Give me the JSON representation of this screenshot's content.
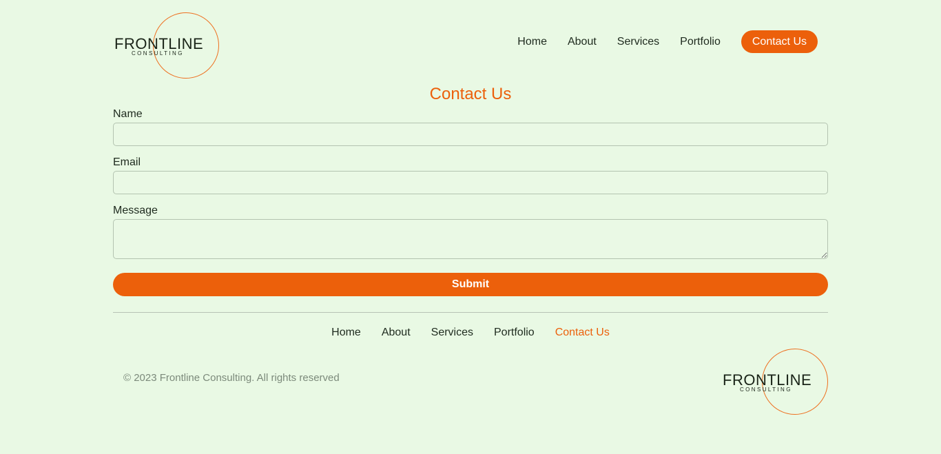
{
  "brand": {
    "name": "FRONTLINE",
    "tagline": "CONSULTING"
  },
  "header": {
    "nav": [
      "Home",
      "About",
      "Services",
      "Portfolio"
    ],
    "cta_label": "Contact Us"
  },
  "form": {
    "title": "Contact Us",
    "name_label": "Name",
    "name_value": "",
    "email_label": "Email",
    "email_value": "",
    "message_label": "Message",
    "message_value": "",
    "submit_label": "Submit"
  },
  "footer": {
    "nav": [
      "Home",
      "About",
      "Services",
      "Portfolio",
      "Contact Us"
    ],
    "active_item": "Contact Us",
    "copyright": "© 2023 Frontline Consulting. All rights reserved"
  },
  "colors": {
    "background": "#e9f9e4",
    "accent": "#ec600b",
    "text": "#1e2a1e",
    "muted_text": "#7c8a7b"
  }
}
